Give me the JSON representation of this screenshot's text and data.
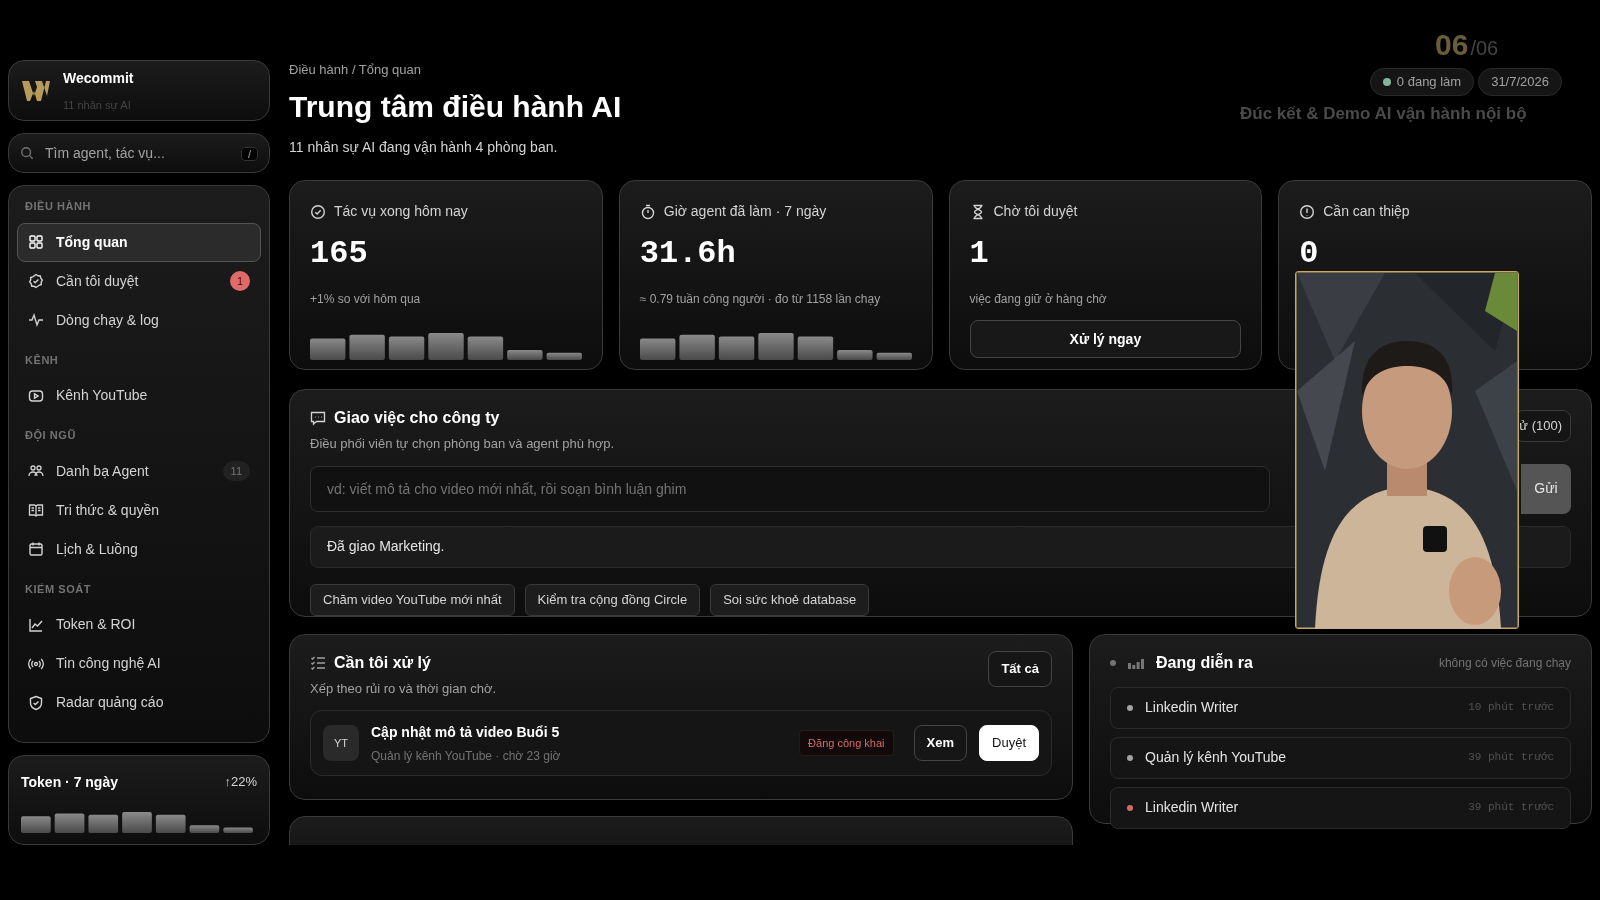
{
  "brand": {
    "name": "Wecommit",
    "subtitle": "11 nhân sự AI"
  },
  "search": {
    "placeholder": "Tìm agent, tác vụ...",
    "shortcut": "/"
  },
  "sidebar": {
    "sections": [
      {
        "title": "ĐIỀU HÀNH",
        "items": [
          {
            "label": "Tổng quan",
            "selected": true
          },
          {
            "label": "Cần tôi duyệt",
            "selected": false,
            "badge": {
              "text": "1",
              "kind": "alert"
            }
          },
          {
            "label": "Dòng chạy & log",
            "selected": false
          }
        ]
      },
      {
        "title": "KÊNH",
        "items": [
          {
            "label": "Kênh YouTube",
            "selected": false
          }
        ]
      },
      {
        "title": "ĐỘI NGŨ",
        "items": [
          {
            "label": "Danh bạ Agent",
            "selected": false,
            "badge": {
              "text": "11",
              "kind": "count"
            }
          },
          {
            "label": "Tri thức & quyền",
            "selected": false
          },
          {
            "label": "Lịch & Luồng",
            "selected": false
          }
        ]
      },
      {
        "title": "KIỂM SOÁT",
        "items": [
          {
            "label": "Token & ROI",
            "selected": false
          },
          {
            "label": "Tin công nghệ AI",
            "selected": false
          },
          {
            "label": "Radar quảng cáo",
            "selected": false
          }
        ]
      }
    ]
  },
  "token_card": {
    "title": "Token · 7 ngày",
    "change": "↑22%"
  },
  "breadcrumb": "Điều hành / Tổng quan",
  "title": "Trung tâm điều hành AI",
  "subtitle": "11 nhân sự AI đang vận hành 4 phòng ban.",
  "header_pills": [
    {
      "text": "0 đang làm",
      "kind": "status",
      "color": "#7fb59a"
    },
    {
      "text": "31/7/2026",
      "kind": "date"
    }
  ],
  "video_overlay": {
    "counter": "06",
    "total": "/06",
    "caption": "Đúc kết & Demo AI vận hành nội bộ"
  },
  "stat_cards": [
    {
      "title": "Tác vụ xong hôm nay",
      "value": "165",
      "note": "+1% so với hôm qua",
      "kind": "sparkline"
    },
    {
      "title": "Giờ agent đã làm · 7 ngày",
      "value": "31.6h",
      "note": "≈ 0.79 tuần công người · đo từ 1158 lần chạy",
      "kind": "sparkline"
    },
    {
      "title": "Chờ tôi duyệt",
      "value": "1",
      "note": "việc đang giữ ở hàng chờ",
      "kind": "action",
      "action": "Xử lý ngay"
    },
    {
      "title": "Cần can thiệp",
      "value": "0",
      "kind": "plain"
    }
  ],
  "assign": {
    "title": "Giao việc cho công ty",
    "subtitle": "Điều phối viên tự chọn phòng ban và agent phù hợp.",
    "corner_button": "ử (100)",
    "placeholder": "vd: viết mô tả cho video mới nhất, rồi soạn bình luận ghim",
    "send": "Gửi",
    "result": "Đã giao Marketing.",
    "suggestions": [
      "Chăm video YouTube mới nhất",
      "Kiểm tra cộng đồng Circle",
      "Soi sức khoẻ database"
    ]
  },
  "todo": {
    "title": "Cần tôi xử lý",
    "subtitle": "Xếp theo rủi ro và thời gian chờ.",
    "all_button": "Tất cả",
    "items": [
      {
        "avatar": "YT",
        "title": "Cập nhật mô tả video Buổi 5",
        "meta": "Quản lý kênh YouTube · chờ 23 giờ",
        "tag": "Đăng công khai",
        "buttons": [
          {
            "label": "Xem",
            "kind": "secondary"
          },
          {
            "label": "Duyệt",
            "kind": "primary"
          }
        ]
      }
    ]
  },
  "live": {
    "title": "Đang diễn ra",
    "status": "không có việc đang chạy",
    "items": [
      {
        "name": "Linkedin Writer",
        "time": "10 phút trước",
        "color": "#a3a3a3"
      },
      {
        "name": "Quản lý kênh YouTube",
        "time": "39 phút trước",
        "color": "#a3a3a3"
      },
      {
        "name": "Linkedin Writer",
        "time": "39 phút trước",
        "color": "#d46a6a"
      }
    ]
  }
}
